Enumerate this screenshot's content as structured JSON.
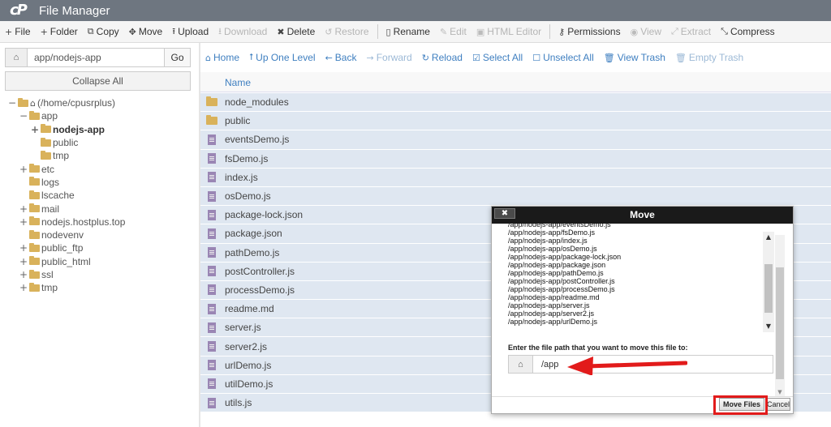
{
  "header": {
    "logo": "cP",
    "title": "File Manager"
  },
  "toolbar": {
    "items": [
      {
        "icon": "+",
        "label": "File",
        "enabled": true
      },
      {
        "icon": "+",
        "label": "Folder",
        "enabled": true
      },
      {
        "icon": "⧉",
        "label": "Copy",
        "enabled": true
      },
      {
        "icon": "✥",
        "label": "Move",
        "enabled": true
      },
      {
        "icon": "⭱",
        "label": "Upload",
        "enabled": true
      },
      {
        "icon": "⭳",
        "label": "Download",
        "enabled": false
      },
      {
        "icon": "✖",
        "label": "Delete",
        "enabled": true
      },
      {
        "icon": "↺",
        "label": "Restore",
        "enabled": false
      },
      {
        "icon": "▯",
        "label": "Rename",
        "enabled": true
      },
      {
        "icon": "✎",
        "label": "Edit",
        "enabled": false
      },
      {
        "icon": "▣",
        "label": "HTML Editor",
        "enabled": false
      },
      {
        "icon": "⚷",
        "label": "Permissions",
        "enabled": true
      },
      {
        "icon": "◉",
        "label": "View",
        "enabled": false
      },
      {
        "icon": "⤢",
        "label": "Extract",
        "enabled": false
      },
      {
        "icon": "⤡",
        "label": "Compress",
        "enabled": true
      }
    ]
  },
  "left": {
    "path_value": "app/nodejs-app",
    "go_label": "Go",
    "collapse_label": "Collapse All",
    "tree": [
      {
        "label": "(/home/cpusrplus)",
        "toggle": "−",
        "indent": 0,
        "home": true,
        "bold": false
      },
      {
        "label": "app",
        "toggle": "−",
        "indent": 1,
        "bold": false
      },
      {
        "label": "nodejs-app",
        "toggle": "+",
        "indent": 2,
        "bold": true
      },
      {
        "label": "public",
        "toggle": "",
        "indent": 2,
        "bold": false
      },
      {
        "label": "tmp",
        "toggle": "",
        "indent": 2,
        "bold": false
      },
      {
        "label": "etc",
        "toggle": "+",
        "indent": 1,
        "bold": false
      },
      {
        "label": "logs",
        "toggle": "",
        "indent": 1,
        "bold": false
      },
      {
        "label": "lscache",
        "toggle": "",
        "indent": 1,
        "bold": false
      },
      {
        "label": "mail",
        "toggle": "+",
        "indent": 1,
        "bold": false
      },
      {
        "label": "nodejs.hostplus.top",
        "toggle": "+",
        "indent": 1,
        "bold": false
      },
      {
        "label": "nodevenv",
        "toggle": "",
        "indent": 1,
        "bold": false
      },
      {
        "label": "public_ftp",
        "toggle": "+",
        "indent": 1,
        "bold": false
      },
      {
        "label": "public_html",
        "toggle": "+",
        "indent": 1,
        "bold": false
      },
      {
        "label": "ssl",
        "toggle": "+",
        "indent": 1,
        "bold": false
      },
      {
        "label": "tmp",
        "toggle": "+",
        "indent": 1,
        "bold": false
      }
    ]
  },
  "nav": {
    "items": [
      {
        "icon": "⌂",
        "label": "Home",
        "enabled": true
      },
      {
        "icon": "⭡",
        "label": "Up One Level",
        "enabled": true
      },
      {
        "icon": "←",
        "label": "Back",
        "enabled": true
      },
      {
        "icon": "→",
        "label": "Forward",
        "enabled": false
      },
      {
        "icon": "↻",
        "label": "Reload",
        "enabled": true
      },
      {
        "icon": "☑",
        "label": "Select All",
        "enabled": true
      },
      {
        "icon": "☐",
        "label": "Unselect All",
        "enabled": true
      },
      {
        "icon": "🗑",
        "label": "View Trash",
        "enabled": true
      },
      {
        "icon": "🗑",
        "label": "Empty Trash",
        "enabled": false
      }
    ]
  },
  "files": {
    "column_name": "Name",
    "rows": [
      {
        "name": "node_modules",
        "type": "folder"
      },
      {
        "name": "public",
        "type": "folder"
      },
      {
        "name": "eventsDemo.js",
        "type": "file"
      },
      {
        "name": "fsDemo.js",
        "type": "file"
      },
      {
        "name": "index.js",
        "type": "file"
      },
      {
        "name": "osDemo.js",
        "type": "file"
      },
      {
        "name": "package-lock.json",
        "type": "file"
      },
      {
        "name": "package.json",
        "type": "file"
      },
      {
        "name": "pathDemo.js",
        "type": "file"
      },
      {
        "name": "postController.js",
        "type": "file"
      },
      {
        "name": "processDemo.js",
        "type": "file"
      },
      {
        "name": "readme.md",
        "type": "file"
      },
      {
        "name": "server.js",
        "type": "file"
      },
      {
        "name": "server2.js",
        "type": "file"
      },
      {
        "name": "urlDemo.js",
        "type": "file"
      },
      {
        "name": "utilDemo.js",
        "type": "file"
      },
      {
        "name": "utils.js",
        "type": "file"
      }
    ]
  },
  "modal": {
    "title": "Move",
    "close_label": "✖",
    "file_list": [
      "/app/nodejs-app/eventsDemo.js",
      "/app/nodejs-app/fsDemo.js",
      "/app/nodejs-app/index.js",
      "/app/nodejs-app/osDemo.js",
      "/app/nodejs-app/package-lock.json",
      "/app/nodejs-app/package.json",
      "/app/nodejs-app/pathDemo.js",
      "/app/nodejs-app/postController.js",
      "/app/nodejs-app/processDemo.js",
      "/app/nodejs-app/readme.md",
      "/app/nodejs-app/server.js",
      "/app/nodejs-app/server2.js",
      "/app/nodejs-app/urlDemo.js"
    ],
    "prompt": "Enter the file path that you want to move this file to:",
    "path_value": "/app",
    "move_label": "Move Files",
    "cancel_label": "Cancel"
  },
  "colors": {
    "header_bg": "#6e7680",
    "row_bg": "#dfe7f1",
    "link": "#3f7fc0",
    "annotation": "#e21b1b"
  }
}
